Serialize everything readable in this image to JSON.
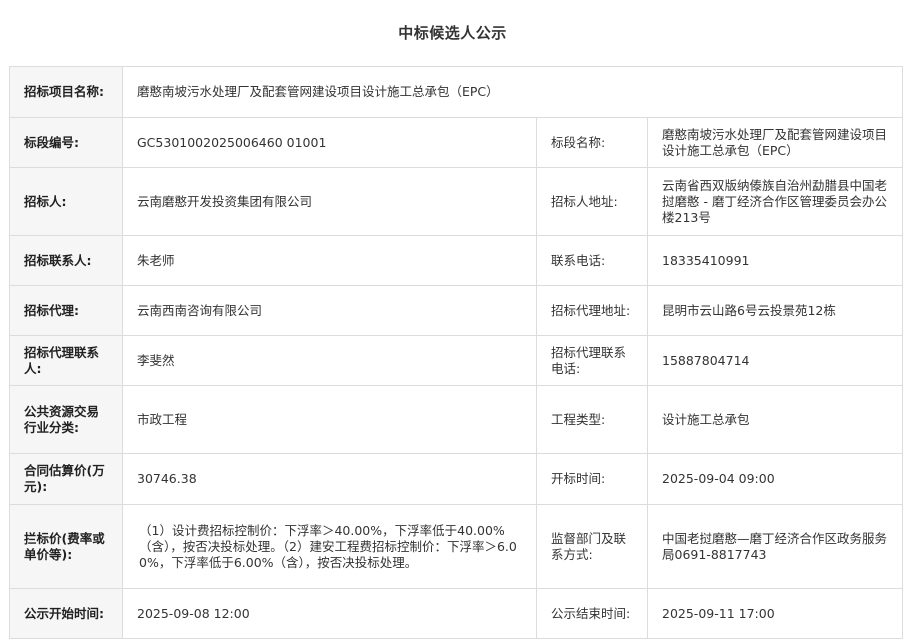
{
  "page_title": "中标候选人公示",
  "rows": {
    "project_name": {
      "label": "招标项目名称:",
      "value": "磨憨南坡污水处理厂及配套管网建设项目设计施工总承包（EPC）"
    },
    "section_no": {
      "label": "标段编号:",
      "value": "GC5301002025006460 01001"
    },
    "section_name": {
      "label": "标段名称:",
      "value": "磨憨南坡污水处理厂及配套管网建设项目设计施工总承包（EPC）"
    },
    "tenderer": {
      "label": "招标人:",
      "value": "云南磨憨开发投资集团有限公司"
    },
    "tenderer_address": {
      "label": "招标人地址:",
      "value": "云南省西双版纳傣族自治州勐腊县中国老挝磨憨 - 磨丁经济合作区管理委员会办公楼213号"
    },
    "tender_contact": {
      "label": "招标联系人:",
      "value": "朱老师"
    },
    "contact_phone": {
      "label": "联系电话:",
      "value": "18335410991"
    },
    "agent": {
      "label": "招标代理:",
      "value": "云南西南咨询有限公司"
    },
    "agent_address": {
      "label": "招标代理地址:",
      "value": "昆明市云山路6号云投景苑12栋"
    },
    "agent_contact": {
      "label": "招标代理联系人:",
      "value": "李斐然"
    },
    "agent_phone": {
      "label": "招标代理联系电话:",
      "value": "15887804714"
    },
    "industry": {
      "label": "公共资源交易行业分类:",
      "value": "市政工程"
    },
    "project_type": {
      "label": "工程类型:",
      "value": "设计施工总承包"
    },
    "estimated_price": {
      "label": "合同估算价(万元):",
      "value": "30746.38"
    },
    "bid_open_time": {
      "label": "开标时间:",
      "value": "2025-09-04 09:00"
    },
    "control_price": {
      "label": "拦标价(费率或单价等):",
      "value": "（1）设计费招标控制价：下浮率＞40.00%，下浮率低于40.00%（含），按否决投标处理。（2）建安工程费招标控制价：下浮率＞6.00%，下浮率低于6.00%（含），按否决投标处理。"
    },
    "supervisor": {
      "label": "监督部门及联系方式:",
      "value": "中国老挝磨憨—磨丁经济合作区政务服务局0691-8817743"
    },
    "publicity_start": {
      "label": "公示开始时间:",
      "value": "2025-09-08 12:00"
    },
    "publicity_end": {
      "label": "公示结束时间:",
      "value": "2025-09-11 17:00"
    }
  }
}
